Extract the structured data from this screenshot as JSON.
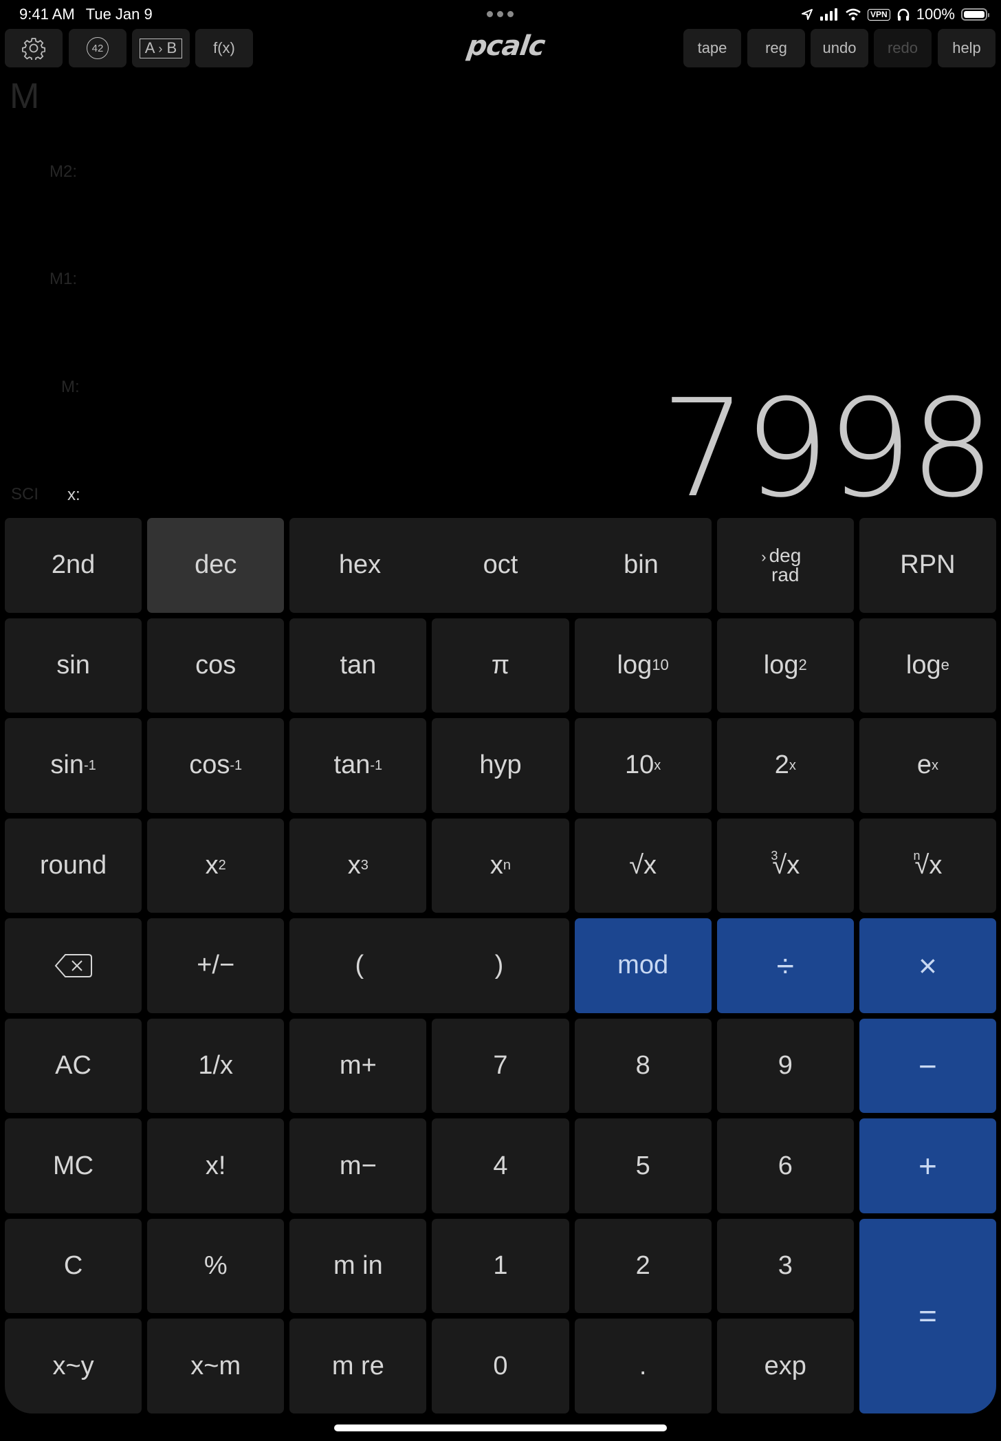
{
  "status_bar": {
    "time": "9:41 AM",
    "date": "Tue Jan 9",
    "icons": [
      "location-arrow-icon",
      "cellular-signal-icon",
      "wifi-icon",
      "vpn-badge",
      "headphones-icon",
      "battery-icon"
    ],
    "vpn_label": "VPN",
    "battery_percent": "100%",
    "battery_level": 1.0
  },
  "toolbar": {
    "left": [
      {
        "name": "settings",
        "icon": "gear-icon"
      },
      {
        "name": "constants",
        "label": "42"
      },
      {
        "name": "conversions",
        "label_a": "A",
        "label_sep": "›",
        "label_b": "B"
      },
      {
        "name": "functions",
        "label": "f(x)"
      }
    ],
    "logo": "pcalc",
    "right": [
      {
        "name": "tape",
        "label": "tape",
        "enabled": true
      },
      {
        "name": "reg",
        "label": "reg",
        "enabled": true
      },
      {
        "name": "undo",
        "label": "undo",
        "enabled": true
      },
      {
        "name": "redo",
        "label": "redo",
        "enabled": false
      },
      {
        "name": "help",
        "label": "help",
        "enabled": true
      }
    ]
  },
  "display": {
    "memory_indicator": "M",
    "registers": {
      "m2": "M2:",
      "m1": "M1:",
      "m": "M:"
    },
    "mode": "SCI",
    "x_label": "x:",
    "value": "7998"
  },
  "keypad": {
    "row1": {
      "second": "2nd",
      "bases": [
        "dec",
        "hex",
        "oct",
        "bin"
      ],
      "selected_base": "dec",
      "angle_current": "deg",
      "angle_alt": "rad",
      "angle_marker": "›",
      "rpn": "RPN"
    },
    "row2": [
      "sin",
      "cos",
      "tan",
      "π",
      {
        "base": "log",
        "sub": "10"
      },
      {
        "base": "log",
        "sub": "2"
      },
      {
        "base": "log",
        "sub": "e"
      }
    ],
    "row3": [
      {
        "base": "sin",
        "sup": "-1"
      },
      {
        "base": "cos",
        "sup": "-1"
      },
      {
        "base": "tan",
        "sup": "-1"
      },
      "hyp",
      {
        "base": "10",
        "sup": "x"
      },
      {
        "base": "2",
        "sup": "x"
      },
      {
        "base": "e",
        "sup": "x"
      }
    ],
    "row4": [
      "round",
      {
        "base": "x",
        "sup": "2"
      },
      {
        "base": "x",
        "sup": "3"
      },
      {
        "base": "x",
        "sup": "n"
      },
      {
        "idx": "",
        "base": "√x"
      },
      {
        "idx": "3",
        "base": "√x"
      },
      {
        "idx": "n",
        "base": "√x"
      }
    ],
    "row5": {
      "backspace": "backspace-icon",
      "sign": "+/−",
      "open_paren": "(",
      "close_paren": ")",
      "mod": "mod",
      "divide": "÷",
      "multiply": "×"
    },
    "row6": [
      "AC",
      "1/x",
      "m+",
      "7",
      "8",
      "9",
      "−"
    ],
    "row7": [
      "MC",
      "x!",
      "m−",
      "4",
      "5",
      "6",
      "+"
    ],
    "row8": [
      "C",
      "%",
      "m in",
      "1",
      "2",
      "3"
    ],
    "row9": [
      "x~y",
      "x~m",
      "m re",
      "0",
      ".",
      "exp"
    ],
    "equals": "="
  },
  "colors": {
    "background": "#000000",
    "key": "#1b1b1b",
    "key_selected": "#333333",
    "operator": "#1c4690",
    "operator_text": "#c8d8f2",
    "text": "#d6d6d6"
  }
}
